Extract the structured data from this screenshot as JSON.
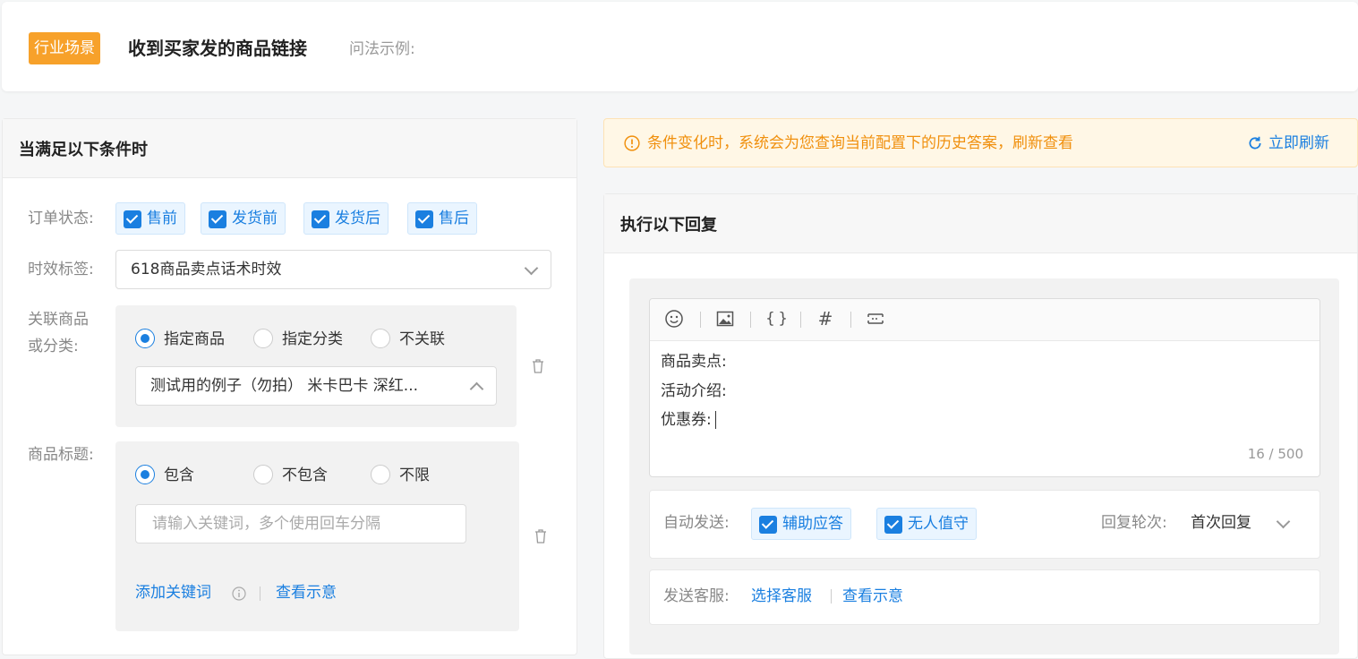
{
  "header": {
    "tag": "行业场景",
    "title": "收到买家发的商品链接",
    "subtitle": "问法示例:"
  },
  "conditions": {
    "title": "当满足以下条件时",
    "order_status": {
      "label": "订单状态:",
      "options": [
        {
          "label": "售前",
          "checked": true
        },
        {
          "label": "发货前",
          "checked": true
        },
        {
          "label": "发货后",
          "checked": true
        },
        {
          "label": "售后",
          "checked": true
        }
      ]
    },
    "time_tag": {
      "label": "时效标签:",
      "value": "618商品卖点话术时效"
    },
    "related": {
      "label_line1": "关联商品",
      "label_line2": "或分类:",
      "options": [
        "指定商品",
        "指定分类",
        "不关联"
      ],
      "selected": "指定商品",
      "select_value": "测试用的例子（勿拍） 米卡巴卡 深红..."
    },
    "product_title": {
      "label": "商品标题:",
      "options": [
        "包含",
        "不包含",
        "不限"
      ],
      "selected": "包含",
      "placeholder": "请输入关键词，多个使用回车分隔",
      "add_link": "添加关键词",
      "view_link": "查看示意"
    }
  },
  "notice": {
    "text": "条件变化时，系统会为您查询当前配置下的历史答案，刷新查看",
    "refresh": "立即刷新"
  },
  "reply": {
    "title": "执行以下回复",
    "toolbar_icons": [
      "emoji-icon",
      "image-icon",
      "braces-icon",
      "hash-icon",
      "line-break-icon"
    ],
    "lines": [
      "商品卖点:",
      "活动介绍:",
      "优惠券:"
    ],
    "counter": "16 / 500",
    "auto_send": {
      "label": "自动发送:",
      "options": [
        {
          "label": "辅助应答",
          "checked": true
        },
        {
          "label": "无人值守",
          "checked": true
        }
      ],
      "round_label": "回复轮次:",
      "round_value": "首次回复"
    },
    "service": {
      "label": "发送客服:",
      "select_link": "选择客服",
      "view_link": "查看示意"
    }
  },
  "colors": {
    "accent": "#1a7fe0",
    "tag": "#f7a12a",
    "notice_text": "#f0900e"
  }
}
